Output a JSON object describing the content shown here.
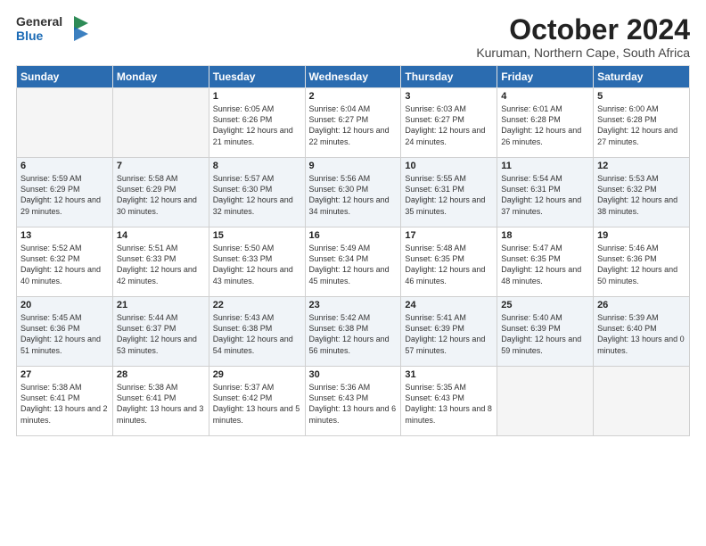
{
  "header": {
    "logo_line1": "General",
    "logo_line2": "Blue",
    "month": "October 2024",
    "location": "Kuruman, Northern Cape, South Africa"
  },
  "weekdays": [
    "Sunday",
    "Monday",
    "Tuesday",
    "Wednesday",
    "Thursday",
    "Friday",
    "Saturday"
  ],
  "weeks": [
    [
      {
        "day": "",
        "sunrise": "",
        "sunset": "",
        "daylight": ""
      },
      {
        "day": "",
        "sunrise": "",
        "sunset": "",
        "daylight": ""
      },
      {
        "day": "1",
        "sunrise": "Sunrise: 6:05 AM",
        "sunset": "Sunset: 6:26 PM",
        "daylight": "Daylight: 12 hours and 21 minutes."
      },
      {
        "day": "2",
        "sunrise": "Sunrise: 6:04 AM",
        "sunset": "Sunset: 6:27 PM",
        "daylight": "Daylight: 12 hours and 22 minutes."
      },
      {
        "day": "3",
        "sunrise": "Sunrise: 6:03 AM",
        "sunset": "Sunset: 6:27 PM",
        "daylight": "Daylight: 12 hours and 24 minutes."
      },
      {
        "day": "4",
        "sunrise": "Sunrise: 6:01 AM",
        "sunset": "Sunset: 6:28 PM",
        "daylight": "Daylight: 12 hours and 26 minutes."
      },
      {
        "day": "5",
        "sunrise": "Sunrise: 6:00 AM",
        "sunset": "Sunset: 6:28 PM",
        "daylight": "Daylight: 12 hours and 27 minutes."
      }
    ],
    [
      {
        "day": "6",
        "sunrise": "Sunrise: 5:59 AM",
        "sunset": "Sunset: 6:29 PM",
        "daylight": "Daylight: 12 hours and 29 minutes."
      },
      {
        "day": "7",
        "sunrise": "Sunrise: 5:58 AM",
        "sunset": "Sunset: 6:29 PM",
        "daylight": "Daylight: 12 hours and 30 minutes."
      },
      {
        "day": "8",
        "sunrise": "Sunrise: 5:57 AM",
        "sunset": "Sunset: 6:30 PM",
        "daylight": "Daylight: 12 hours and 32 minutes."
      },
      {
        "day": "9",
        "sunrise": "Sunrise: 5:56 AM",
        "sunset": "Sunset: 6:30 PM",
        "daylight": "Daylight: 12 hours and 34 minutes."
      },
      {
        "day": "10",
        "sunrise": "Sunrise: 5:55 AM",
        "sunset": "Sunset: 6:31 PM",
        "daylight": "Daylight: 12 hours and 35 minutes."
      },
      {
        "day": "11",
        "sunrise": "Sunrise: 5:54 AM",
        "sunset": "Sunset: 6:31 PM",
        "daylight": "Daylight: 12 hours and 37 minutes."
      },
      {
        "day": "12",
        "sunrise": "Sunrise: 5:53 AM",
        "sunset": "Sunset: 6:32 PM",
        "daylight": "Daylight: 12 hours and 38 minutes."
      }
    ],
    [
      {
        "day": "13",
        "sunrise": "Sunrise: 5:52 AM",
        "sunset": "Sunset: 6:32 PM",
        "daylight": "Daylight: 12 hours and 40 minutes."
      },
      {
        "day": "14",
        "sunrise": "Sunrise: 5:51 AM",
        "sunset": "Sunset: 6:33 PM",
        "daylight": "Daylight: 12 hours and 42 minutes."
      },
      {
        "day": "15",
        "sunrise": "Sunrise: 5:50 AM",
        "sunset": "Sunset: 6:33 PM",
        "daylight": "Daylight: 12 hours and 43 minutes."
      },
      {
        "day": "16",
        "sunrise": "Sunrise: 5:49 AM",
        "sunset": "Sunset: 6:34 PM",
        "daylight": "Daylight: 12 hours and 45 minutes."
      },
      {
        "day": "17",
        "sunrise": "Sunrise: 5:48 AM",
        "sunset": "Sunset: 6:35 PM",
        "daylight": "Daylight: 12 hours and 46 minutes."
      },
      {
        "day": "18",
        "sunrise": "Sunrise: 5:47 AM",
        "sunset": "Sunset: 6:35 PM",
        "daylight": "Daylight: 12 hours and 48 minutes."
      },
      {
        "day": "19",
        "sunrise": "Sunrise: 5:46 AM",
        "sunset": "Sunset: 6:36 PM",
        "daylight": "Daylight: 12 hours and 50 minutes."
      }
    ],
    [
      {
        "day": "20",
        "sunrise": "Sunrise: 5:45 AM",
        "sunset": "Sunset: 6:36 PM",
        "daylight": "Daylight: 12 hours and 51 minutes."
      },
      {
        "day": "21",
        "sunrise": "Sunrise: 5:44 AM",
        "sunset": "Sunset: 6:37 PM",
        "daylight": "Daylight: 12 hours and 53 minutes."
      },
      {
        "day": "22",
        "sunrise": "Sunrise: 5:43 AM",
        "sunset": "Sunset: 6:38 PM",
        "daylight": "Daylight: 12 hours and 54 minutes."
      },
      {
        "day": "23",
        "sunrise": "Sunrise: 5:42 AM",
        "sunset": "Sunset: 6:38 PM",
        "daylight": "Daylight: 12 hours and 56 minutes."
      },
      {
        "day": "24",
        "sunrise": "Sunrise: 5:41 AM",
        "sunset": "Sunset: 6:39 PM",
        "daylight": "Daylight: 12 hours and 57 minutes."
      },
      {
        "day": "25",
        "sunrise": "Sunrise: 5:40 AM",
        "sunset": "Sunset: 6:39 PM",
        "daylight": "Daylight: 12 hours and 59 minutes."
      },
      {
        "day": "26",
        "sunrise": "Sunrise: 5:39 AM",
        "sunset": "Sunset: 6:40 PM",
        "daylight": "Daylight: 13 hours and 0 minutes."
      }
    ],
    [
      {
        "day": "27",
        "sunrise": "Sunrise: 5:38 AM",
        "sunset": "Sunset: 6:41 PM",
        "daylight": "Daylight: 13 hours and 2 minutes."
      },
      {
        "day": "28",
        "sunrise": "Sunrise: 5:38 AM",
        "sunset": "Sunset: 6:41 PM",
        "daylight": "Daylight: 13 hours and 3 minutes."
      },
      {
        "day": "29",
        "sunrise": "Sunrise: 5:37 AM",
        "sunset": "Sunset: 6:42 PM",
        "daylight": "Daylight: 13 hours and 5 minutes."
      },
      {
        "day": "30",
        "sunrise": "Sunrise: 5:36 AM",
        "sunset": "Sunset: 6:43 PM",
        "daylight": "Daylight: 13 hours and 6 minutes."
      },
      {
        "day": "31",
        "sunrise": "Sunrise: 5:35 AM",
        "sunset": "Sunset: 6:43 PM",
        "daylight": "Daylight: 13 hours and 8 minutes."
      },
      {
        "day": "",
        "sunrise": "",
        "sunset": "",
        "daylight": ""
      },
      {
        "day": "",
        "sunrise": "",
        "sunset": "",
        "daylight": ""
      }
    ]
  ]
}
